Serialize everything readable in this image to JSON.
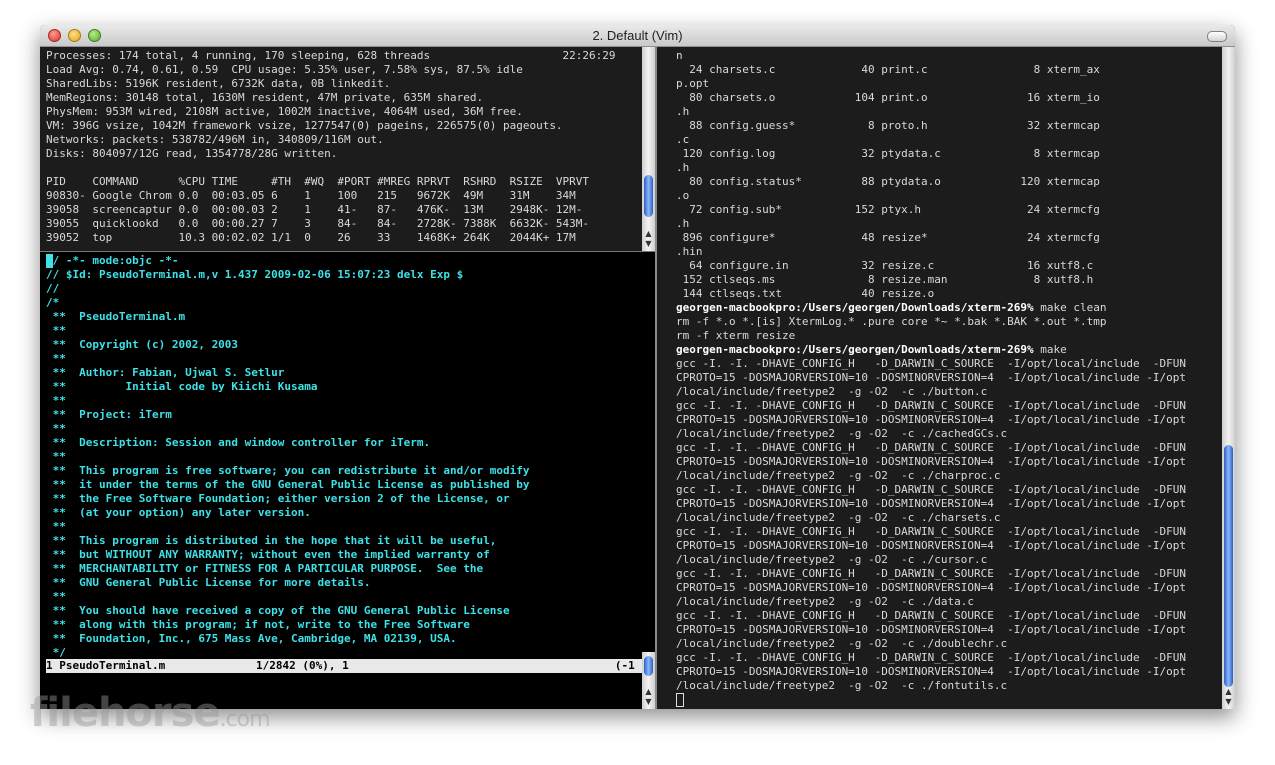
{
  "window": {
    "title": "2. Default (Vim)"
  },
  "top_pane": {
    "lines": [
      "Processes: 174 total, 4 running, 170 sleeping, 628 threads                    22:26:29",
      "Load Avg: 0.74, 0.61, 0.59  CPU usage: 5.35% user, 7.58% sys, 87.5% idle",
      "SharedLibs: 5196K resident, 6732K data, 0B linkedit.",
      "MemRegions: 30148 total, 1630M resident, 47M private, 635M shared.",
      "PhysMem: 953M wired, 2108M active, 1002M inactive, 4064M used, 36M free.",
      "VM: 396G vsize, 1042M framework vsize, 1277547(0) pageins, 226575(0) pageouts.",
      "Networks: packets: 538782/496M in, 340809/116M out.",
      "Disks: 804097/12G read, 1354778/28G written.",
      "",
      "PID    COMMAND      %CPU TIME     #TH  #WQ  #PORT #MREG RPRVT  RSHRD  RSIZE  VPRVT",
      "90830- Google Chrom 0.0  00:03.05 6    1    100   215   9672K  49M    31M    34M",
      "39058  screencaptur 0.0  00:00.03 2    1    41-   87-   476K-  13M    2948K- 12M-",
      "39055  quicklookd   0.0  00:00.27 7    3    84-   84-   2728K- 7388K  6632K- 543M-",
      "39052  top          10.3 00:02.02 1/1  0    26    33    1468K+ 264K   2044K+ 17M"
    ]
  },
  "vim_pane": {
    "lines": [
      "// -*- mode:objc -*-",
      "// $Id: PseudoTerminal.m,v 1.437 2009-02-06 15:07:23 delx Exp $",
      "//",
      "/*",
      " **  PseudoTerminal.m",
      " **",
      " **  Copyright (c) 2002, 2003",
      " **",
      " **  Author: Fabian, Ujwal S. Setlur",
      " **         Initial code by Kiichi Kusama",
      " **",
      " **  Project: iTerm",
      " **",
      " **  Description: Session and window controller for iTerm.",
      " **",
      " **  This program is free software; you can redistribute it and/or modify",
      " **  it under the terms of the GNU General Public License as published by",
      " **  the Free Software Foundation; either version 2 of the License, or",
      " **  (at your option) any later version.",
      " **",
      " **  This program is distributed in the hope that it will be useful,",
      " **  but WITHOUT ANY WARRANTY; without even the implied warranty of",
      " **  MERCHANTABILITY or FITNESS FOR A PARTICULAR PURPOSE.  See the",
      " **  GNU General Public License for more details.",
      " **",
      " **  You should have received a copy of the GNU General Public License",
      " **  along with this program; if not, write to the Free Software",
      " **  Foundation, Inc., 675 Mass Ave, Cambridge, MA 02139, USA.",
      " */"
    ],
    "status": {
      "left": "1 PseudoTerminal.m",
      "mid": "1/2842 (0%), 1",
      "right": "(-1 )"
    }
  },
  "right_pane": {
    "lines_before": [
      "n",
      "  24 charsets.c             40 print.c                8 xterm_ax",
      "p.opt",
      "  80 charsets.o            104 print.o               16 xterm_io",
      ".h",
      "  88 config.guess*           8 proto.h               32 xtermcap",
      ".c",
      " 120 config.log             32 ptydata.c              8 xtermcap",
      ".h",
      "  80 config.status*         88 ptydata.o            120 xtermcap",
      ".o",
      "  72 config.sub*           152 ptyx.h                24 xtermcfg",
      ".h",
      " 896 configure*             48 resize*               24 xtermcfg",
      ".hin",
      "  64 configure.in           32 resize.c              16 xutf8.c",
      " 152 ctlseqs.ms              8 resize.man             8 xutf8.h",
      " 144 ctlseqs.txt            40 resize.o"
    ],
    "prompt1": "georgen-macbookpro:/Users/georgen/Downloads/xterm-269%",
    "command1": " make clean",
    "lines_mid": [
      "rm -f *.o *.[is] XtermLog.* .pure core *~ *.bak *.BAK *.out *.tmp",
      "rm -f xterm resize"
    ],
    "prompt2": "georgen-macbookpro:/Users/georgen/Downloads/xterm-269%",
    "command2": " make",
    "lines_after": [
      "gcc -I. -I. -DHAVE_CONFIG_H   -D_DARWIN_C_SOURCE  -I/opt/local/include  -DFUN",
      "CPROTO=15 -DOSMAJORVERSION=10 -DOSMINORVERSION=4  -I/opt/local/include -I/opt",
      "/local/include/freetype2  -g -O2  -c ./button.c",
      "gcc -I. -I. -DHAVE_CONFIG_H   -D_DARWIN_C_SOURCE  -I/opt/local/include  -DFUN",
      "CPROTO=15 -DOSMAJORVERSION=10 -DOSMINORVERSION=4  -I/opt/local/include -I/opt",
      "/local/include/freetype2  -g -O2  -c ./cachedGCs.c",
      "gcc -I. -I. -DHAVE_CONFIG_H   -D_DARWIN_C_SOURCE  -I/opt/local/include  -DFUN",
      "CPROTO=15 -DOSMAJORVERSION=10 -DOSMINORVERSION=4  -I/opt/local/include -I/opt",
      "/local/include/freetype2  -g -O2  -c ./charproc.c",
      "gcc -I. -I. -DHAVE_CONFIG_H   -D_DARWIN_C_SOURCE  -I/opt/local/include  -DFUN",
      "CPROTO=15 -DOSMAJORVERSION=10 -DOSMINORVERSION=4  -I/opt/local/include -I/opt",
      "/local/include/freetype2  -g -O2  -c ./charsets.c",
      "gcc -I. -I. -DHAVE_CONFIG_H   -D_DARWIN_C_SOURCE  -I/opt/local/include  -DFUN",
      "CPROTO=15 -DOSMAJORVERSION=10 -DOSMINORVERSION=4  -I/opt/local/include -I/opt",
      "/local/include/freetype2  -g -O2  -c ./cursor.c",
      "gcc -I. -I. -DHAVE_CONFIG_H   -D_DARWIN_C_SOURCE  -I/opt/local/include  -DFUN",
      "CPROTO=15 -DOSMAJORVERSION=10 -DOSMINORVERSION=4  -I/opt/local/include -I/opt",
      "/local/include/freetype2  -g -O2  -c ./data.c",
      "gcc -I. -I. -DHAVE_CONFIG_H   -D_DARWIN_C_SOURCE  -I/opt/local/include  -DFUN",
      "CPROTO=15 -DOSMAJORVERSION=10 -DOSMINORVERSION=4  -I/opt/local/include -I/opt",
      "/local/include/freetype2  -g -O2  -c ./doublechr.c",
      "gcc -I. -I. -DHAVE_CONFIG_H   -D_DARWIN_C_SOURCE  -I/opt/local/include  -DFUN",
      "CPROTO=15 -DOSMAJORVERSION=10 -DOSMINORVERSION=4  -I/opt/local/include -I/opt",
      "/local/include/freetype2  -g -O2  -c ./fontutils.c"
    ]
  },
  "scrollbars": {
    "up_arrow": "▲",
    "down_arrow": "▼"
  },
  "watermark": {
    "text": "filehorse",
    "suffix": ".com"
  },
  "colors": {
    "vim_text": "#3fe0e6",
    "terminal_text": "#d9d9d9",
    "background": "#1c1c1c"
  }
}
